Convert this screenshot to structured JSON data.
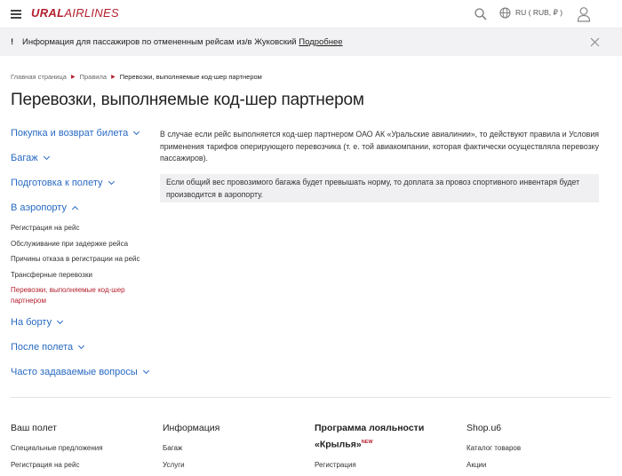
{
  "header": {
    "logo_bold": "URAL",
    "logo_light": "AIRLINES",
    "lang_label": "RU ( RUB, ₽ )"
  },
  "notice": {
    "bang": "!",
    "text": "Информация для пассажиров по отмененным рейсам из/в Жуковский ",
    "more": "Подробнее"
  },
  "breadcrumb": [
    "Главная страница",
    "Правила",
    "Перевозки, выполняемые код-шер партнером"
  ],
  "page_title": "Перевозки, выполняемые код-шер партнером",
  "sidenav": {
    "sections_top": [
      "Покупка и возврат билета",
      "Багаж",
      "Подготовка к полету"
    ],
    "open_section": "В аэропорту",
    "sub_items": [
      "Регистрация на рейс",
      "Обслуживание при задержке рейса",
      "Причины отказа в регистрации на рейс",
      "Трансферные перевозки"
    ],
    "active_item": "Перевозки, выполняемые код-шер партнером",
    "sections_bottom": [
      "На борту",
      "После полета",
      "Часто задаваемые вопросы"
    ]
  },
  "content": {
    "paragraph": "В случае если рейс выполняется код-шер партнером ОАО АК «Уральские авиалинии», то действуют правила и Условия применения тарифов оперирующего перевозчика (т. е. той авиакомпании, которая фактически осуществляла перевозку пассажиров).",
    "note": "Если общий вес провозимого багажа будет превышать норму, то доплата за провоз спортивного инвентаря будет производится в аэропорту."
  },
  "footer": {
    "col1": {
      "title": "Ваш полет",
      "links": [
        "Специальные предложения",
        "Регистрация на рейс"
      ]
    },
    "col2": {
      "title": "Информация",
      "links": [
        "Багаж",
        "Услуги"
      ]
    },
    "col3": {
      "title_line1": "Программа лояльности",
      "title_line2": "«Крылья»",
      "badge": "NEW",
      "links": [
        "Регистрация"
      ]
    },
    "col4": {
      "title": "Shop.u6",
      "links": [
        "Каталог товаров",
        "Акции"
      ]
    }
  },
  "colors": {
    "brand": "#b41f2d",
    "link": "#2769c2"
  }
}
